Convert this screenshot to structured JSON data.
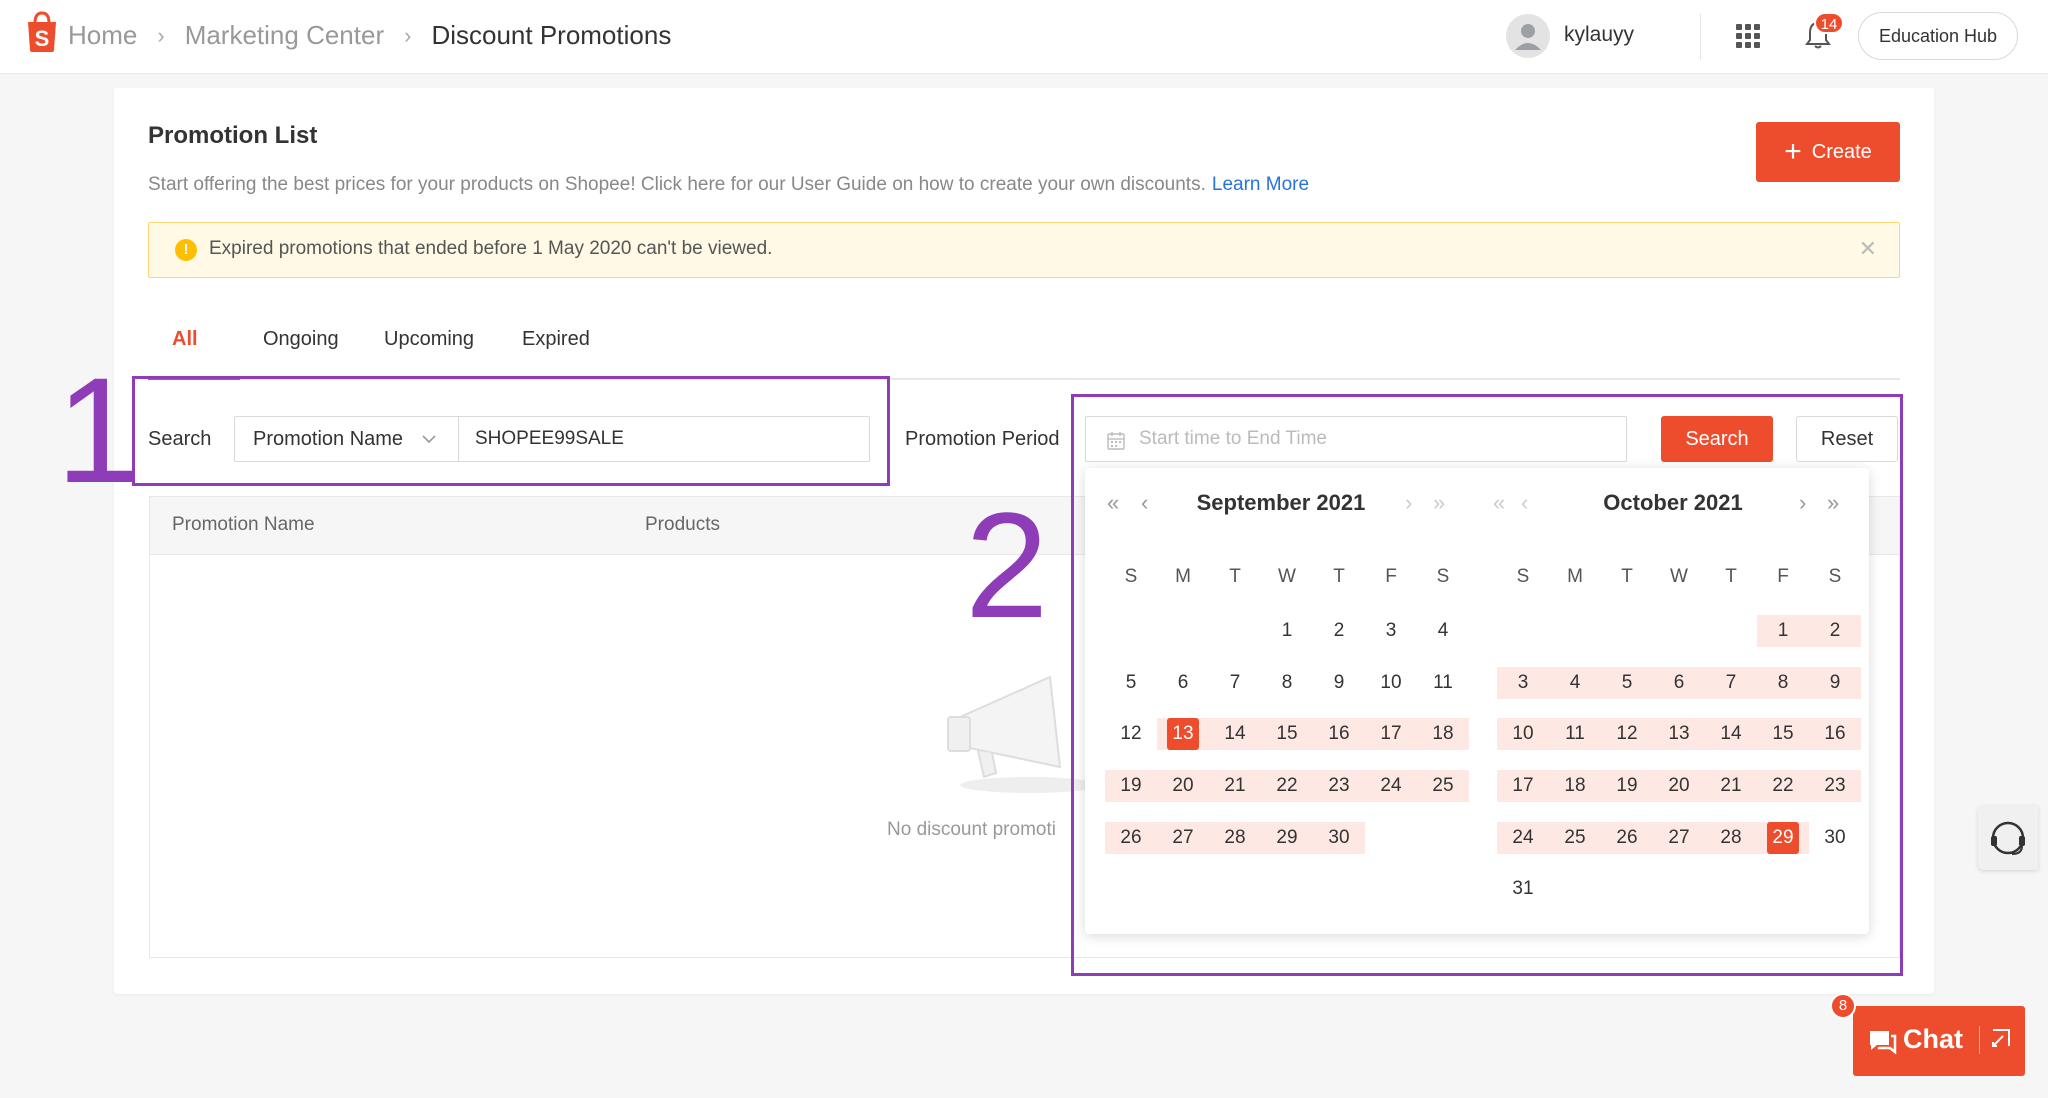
{
  "header": {
    "breadcrumbs": [
      "Home",
      "Marketing Center",
      "Discount Promotions"
    ],
    "username": "kylauyy",
    "notification_count": "14",
    "education_hub": "Education Hub",
    "brand_color": "#ee4d2d"
  },
  "page": {
    "title": "Promotion List",
    "description": "Start offering the best prices for your products on Shopee! Click here for our User Guide on how to create your own discounts.",
    "learn_more": "Learn More",
    "create_label": "Create"
  },
  "notice": {
    "text": "Expired promotions that ended before 1 May 2020 can't be viewed."
  },
  "tabs": [
    "All",
    "Ongoing",
    "Upcoming",
    "Expired"
  ],
  "active_tab": "All",
  "filters": {
    "search_label": "Search",
    "search_type": "Promotion Name",
    "search_value": "SHOPEE99SALE",
    "period_label": "Promotion Period",
    "period_placeholder": "Start time to End Time",
    "search_button": "Search",
    "reset_button": "Reset"
  },
  "table": {
    "columns": [
      "Promotion Name",
      "Products"
    ],
    "empty_text": "No discount promoti"
  },
  "datepicker": {
    "weekdays": [
      "S",
      "M",
      "T",
      "W",
      "T",
      "F",
      "S"
    ],
    "months": [
      {
        "title": "September 2021",
        "first_weekday": 3,
        "days": 30
      },
      {
        "title": "October 2021",
        "first_weekday": 5,
        "days": 31
      }
    ],
    "range_start": {
      "month": 0,
      "day": 13
    },
    "range_end": {
      "month": 1,
      "day": 29
    }
  },
  "annotations": {
    "label_1": "1",
    "label_2": "2"
  },
  "chat": {
    "label": "Chat",
    "badge": "8"
  }
}
